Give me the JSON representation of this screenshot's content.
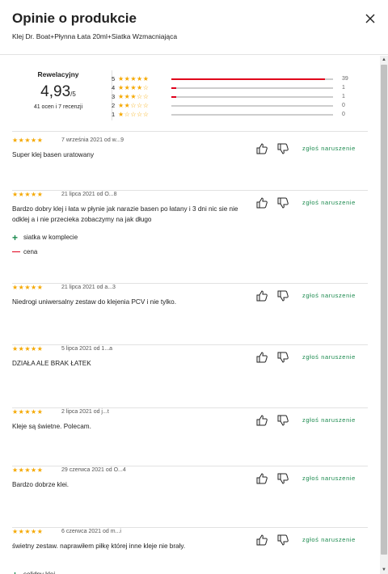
{
  "header": {
    "title": "Opinie o produkcie",
    "subtitle": "Klej Dr. Boat+Płynna Łata 20ml+Siatka Wzmacniająca",
    "close_icon": "close-icon"
  },
  "summary": {
    "rating_word": "Rewelacyjny",
    "score": "4,93",
    "score_suffix": "/5",
    "count_text": "41 ocen i 7 recenzji",
    "bars": [
      {
        "label": "5",
        "stars": "★★★★★",
        "count": "39",
        "fraction": 0.95
      },
      {
        "label": "4",
        "stars": "★★★★☆",
        "count": "1",
        "fraction": 0.02
      },
      {
        "label": "3",
        "stars": "★★★☆☆",
        "count": "1",
        "fraction": 0.02
      },
      {
        "label": "2",
        "stars": "★★☆☆☆",
        "count": "0",
        "fraction": 0
      },
      {
        "label": "1",
        "stars": "★☆☆☆☆",
        "count": "0",
        "fraction": 0
      }
    ]
  },
  "report_label": "zgłoś naruszenie",
  "reviews": [
    {
      "stars": "★★★★★",
      "meta": "7 września 2021 od w...9",
      "text": "Super klej basen uratowany"
    },
    {
      "stars": "★★★★★",
      "meta": "21 lipca 2021 od O...8",
      "text": "Bardzo dobry klej i łata w płynie jak narazie basen po łatany i 3 dni nic sie nie odklej a i nie przecieka zobaczymy na jak długo",
      "pros": [
        "siatka w komplecie"
      ],
      "cons": [
        "cena"
      ]
    },
    {
      "stars": "★★★★★",
      "meta": "21 lipca 2021 od a...3",
      "text": "Niedrogi uniwersalny zestaw do klejenia PCV i nie tylko."
    },
    {
      "stars": "★★★★★",
      "meta": "5 lipca 2021 od 1...a",
      "text": "DZIAŁA ALE BRAK ŁATEK"
    },
    {
      "stars": "★★★★★",
      "meta": "2 lipca 2021 od j...t",
      "text": "Kleje są świetne. Polecam."
    },
    {
      "stars": "★★★★★",
      "meta": "29 czerwca 2021 od O...4",
      "text": "Bardzo dobrze klei."
    },
    {
      "stars": "★★★★★",
      "meta": "6 czerwca 2021 od m...i",
      "text": "świetny zestaw. naprawiłem piłkę której inne kleje nie brały.",
      "pros": [
        "solidny klej"
      ]
    }
  ],
  "colors": {
    "accent_red": "#e0001b",
    "star": "#f5a800",
    "report_green": "#1b8a4e"
  }
}
